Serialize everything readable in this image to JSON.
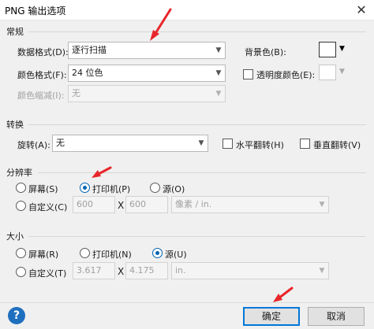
{
  "window": {
    "title": "PNG 输出选项",
    "close_glyph": "✕"
  },
  "general": {
    "section_title": "常规",
    "data_format": {
      "label": "数据格式(D):",
      "value": "逐行扫描"
    },
    "color_format": {
      "label": "颜色格式(F):",
      "value": "24 位色"
    },
    "color_reduction": {
      "label": "颜色缩减(I):",
      "value": "无"
    },
    "background_color": {
      "label": "背景色(B):"
    },
    "transparency_color": {
      "label": "透明度颜色(E):"
    }
  },
  "transform": {
    "section_title": "转换",
    "rotate": {
      "label": "旋转(A):",
      "value": "无"
    },
    "flip_horizontal": "水平翻转(H)",
    "flip_vertical": "垂直翻转(V)"
  },
  "resolution": {
    "section_title": "分辨率",
    "options": {
      "screen": "屏幕(S)",
      "printer": "打印机(P)",
      "source": "源(O)",
      "custom": "自定义(C)"
    },
    "selected": "printer",
    "width": "600",
    "times": "X",
    "height": "600",
    "unit": "像素 / in."
  },
  "size": {
    "section_title": "大小",
    "options": {
      "screen": "屏幕(R)",
      "printer": "打印机(N)",
      "source": "源(U)",
      "custom": "自定义(T)"
    },
    "selected": "source",
    "width": "3.617",
    "times": "X",
    "height": "4.175",
    "unit": "in."
  },
  "footer": {
    "help_glyph": "?",
    "ok": "确定",
    "cancel": "取消"
  },
  "annotations": {
    "arrow_color": "#e8262b"
  }
}
